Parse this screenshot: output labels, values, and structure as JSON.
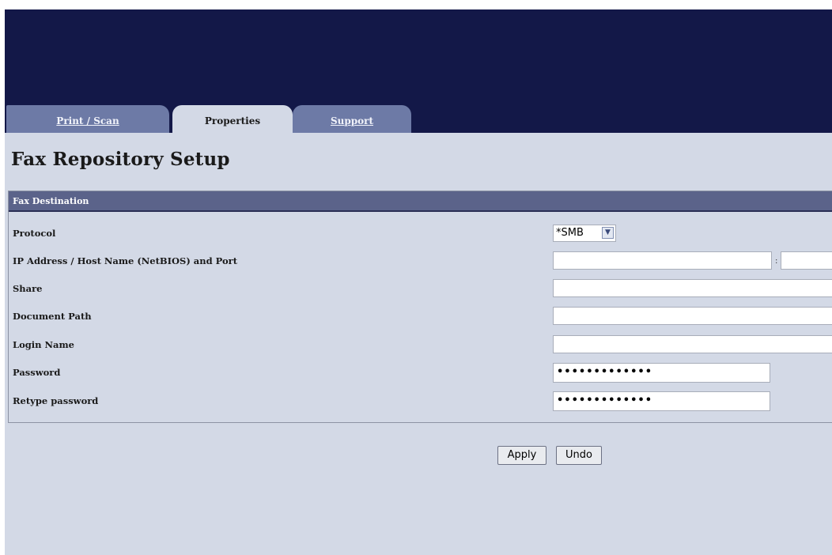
{
  "tabs": [
    {
      "label": "Print / Scan",
      "active": false
    },
    {
      "label": "Properties",
      "active": true
    },
    {
      "label": "Support",
      "active": false
    }
  ],
  "page_title": "Fax Repository Setup",
  "panel": {
    "header": "Fax Destination",
    "fields": {
      "protocol": {
        "label": "Protocol",
        "value": "*SMB",
        "icon": "chevron-down-icon"
      },
      "ip_address": {
        "label": "IP Address / Host Name (NetBIOS) and Port",
        "host_value": "",
        "port_separator": ":",
        "port_value": ""
      },
      "share": {
        "label": "Share",
        "value": ""
      },
      "document_path": {
        "label": "Document Path",
        "value": ""
      },
      "login_name": {
        "label": "Login Name",
        "value": ""
      },
      "password": {
        "label": "Password",
        "value": "•••••••••••••"
      },
      "retype_password": {
        "label": "Retype password",
        "value": "•••••••••••••"
      }
    }
  },
  "buttons": {
    "apply": "Apply",
    "undo": "Undo"
  },
  "colors": {
    "banner": "#131848",
    "background": "#d3d9e6",
    "tab_inactive": "#6d7aa6",
    "panel_header": "#5b638a"
  }
}
